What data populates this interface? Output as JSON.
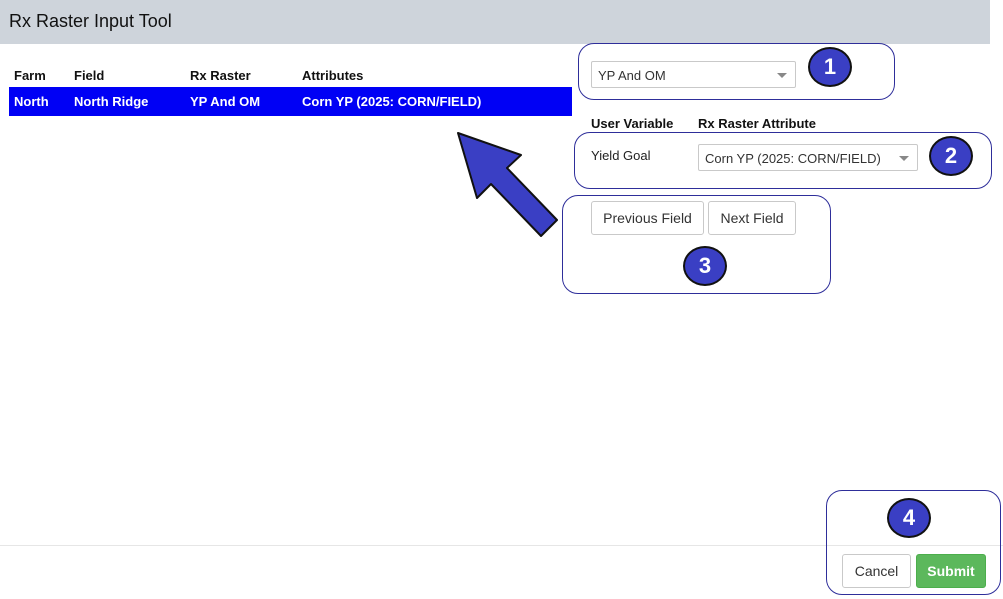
{
  "window": {
    "title": "Rx Raster Input Tool"
  },
  "table": {
    "headers": [
      "Farm",
      "Field",
      "Rx Raster",
      "Attributes"
    ],
    "rows": [
      {
        "farm": "North",
        "field": "North Ridge",
        "rx_raster": "YP And OM",
        "attributes": "Corn YP (2025: CORN/FIELD)"
      }
    ]
  },
  "raster_select": {
    "value": "YP And OM"
  },
  "mapping": {
    "header_user_variable": "User Variable",
    "header_rx_attribute": "Rx Raster Attribute",
    "rows": [
      {
        "variable": "Yield Goal",
        "attribute": "Corn YP (2025: CORN/FIELD)"
      }
    ]
  },
  "nav": {
    "previous_label": "Previous Field",
    "next_label": "Next Field"
  },
  "footer": {
    "cancel_label": "Cancel",
    "submit_label": "Submit"
  },
  "callouts": {
    "one": "1",
    "two": "2",
    "three": "3",
    "four": "4"
  },
  "colors": {
    "selected_row": "#0000f5",
    "badge": "#3a3fc4",
    "submit": "#5cb85c",
    "titlebar": "#ced4db"
  },
  "icons": {
    "dropdown": "chevron-down-icon",
    "pointer": "arrow-icon"
  }
}
